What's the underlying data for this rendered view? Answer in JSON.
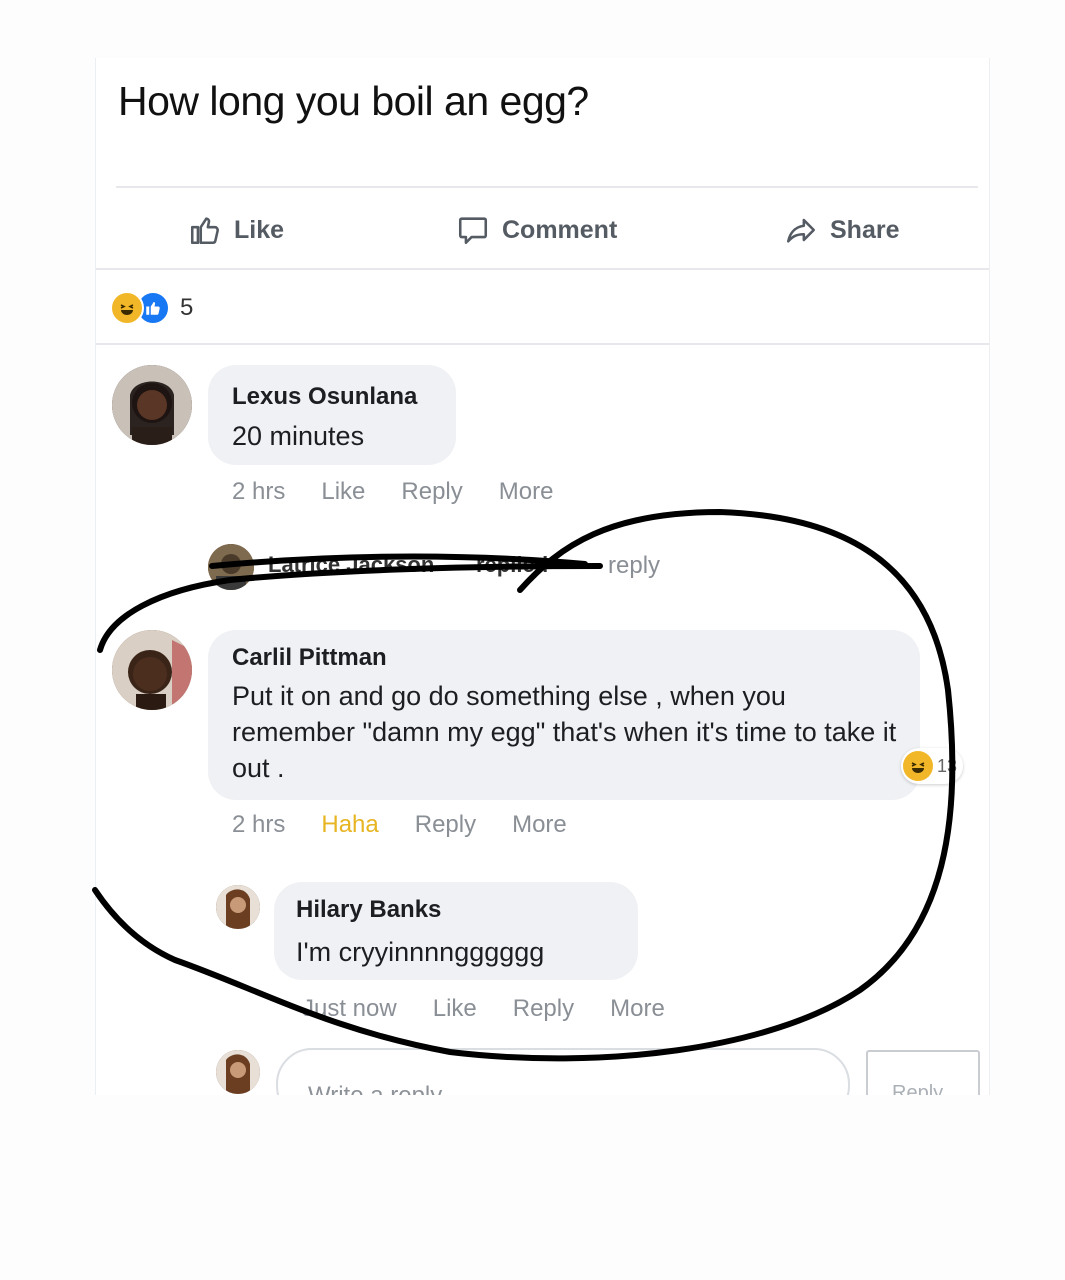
{
  "post": {
    "text": "How long you boil an egg?",
    "actions": {
      "like": "Like",
      "comment": "Comment",
      "share": "Share"
    },
    "reaction_count": "5"
  },
  "comments": [
    {
      "name": "Lexus Osunlana",
      "text": "20 minutes",
      "meta": {
        "time": "2 hrs",
        "like": "Like",
        "reply": "Reply",
        "more": "More"
      }
    },
    {
      "name": "Carlil Pittman",
      "text": "Put it on and go do something else , when you remember \"damn my egg\" that's when it's time to take it out .",
      "reaction_count": "13",
      "meta": {
        "time": "2 hrs",
        "like": "Haha",
        "reply": "Reply",
        "more": "More"
      }
    }
  ],
  "replied_line": {
    "name": "Latrice Jackson",
    "text": "replied",
    "suffix": "reply"
  },
  "reply": {
    "name": "Hilary Banks",
    "text": "I'm cryyinnnngggggg",
    "meta": {
      "time": "Just now",
      "like": "Like",
      "reply": "Reply",
      "more": "More"
    }
  },
  "reply_box": {
    "placeholder": "Write a reply",
    "button": "Reply"
  },
  "colors": {
    "like_blue": "#1877f2",
    "haha_yellow": "#f2b728",
    "bubble": "#eff1f4",
    "ink": "#000000"
  }
}
